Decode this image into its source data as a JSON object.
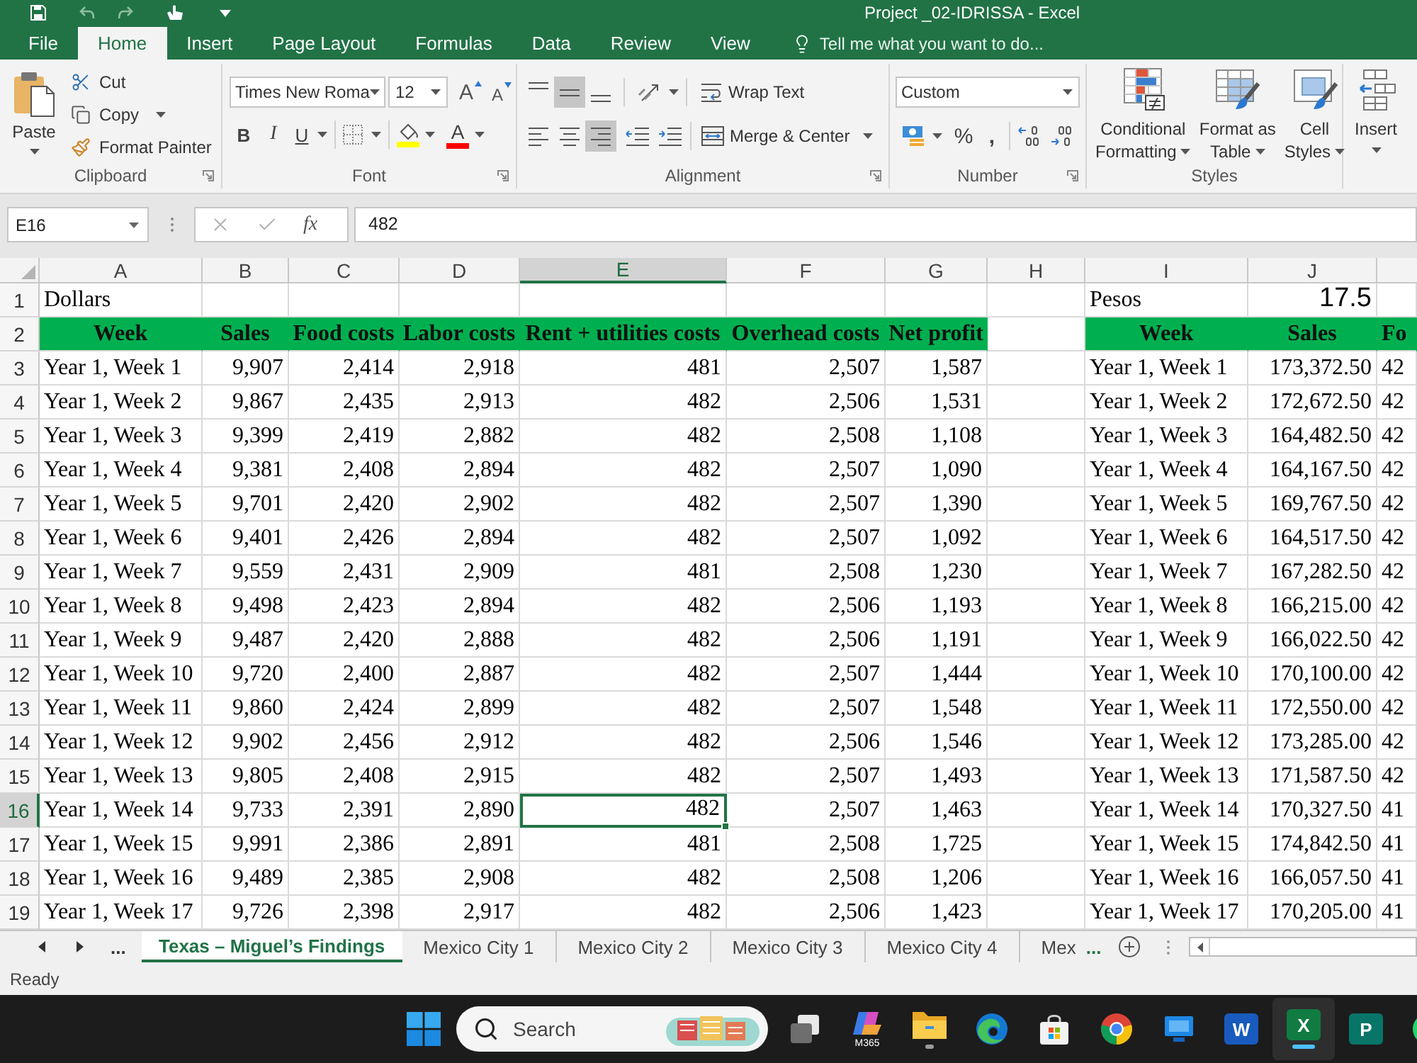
{
  "title_bar": {
    "title": "Project _02-IDRISSA - Excel"
  },
  "ribbon_tabs": [
    {
      "label": "File",
      "selected": false
    },
    {
      "label": "Home",
      "selected": true
    },
    {
      "label": "Insert",
      "selected": false
    },
    {
      "label": "Page Layout",
      "selected": false
    },
    {
      "label": "Formulas",
      "selected": false
    },
    {
      "label": "Data",
      "selected": false
    },
    {
      "label": "Review",
      "selected": false
    },
    {
      "label": "View",
      "selected": false
    }
  ],
  "tell_me": {
    "placeholder": "Tell me what you want to do..."
  },
  "ribbon": {
    "clipboard": {
      "label": "Clipboard",
      "paste": "Paste",
      "cut": "Cut",
      "copy": "Copy",
      "format_painter": "Format Painter"
    },
    "font": {
      "label": "Font",
      "font_name": "Times New Roma",
      "font_size": "12",
      "grow": "A",
      "shrink": "A",
      "bold": "B",
      "italic": "I",
      "underline": "U",
      "font_color": "A"
    },
    "alignment": {
      "label": "Alignment",
      "vertical": [
        {
          "kind": "top",
          "selected": false
        },
        {
          "kind": "middle",
          "selected": true
        },
        {
          "kind": "bottom",
          "selected": false
        }
      ],
      "horizontal": [
        {
          "kind": "left",
          "selected": false
        },
        {
          "kind": "center",
          "selected": false
        },
        {
          "kind": "right",
          "selected": true
        }
      ],
      "wrap_text": "Wrap Text",
      "merge_center": "Merge & Center"
    },
    "number": {
      "label": "Number",
      "format": "Custom",
      "percent": "%",
      "comma": ","
    },
    "styles": {
      "label": "Styles",
      "buttons": [
        {
          "kind": "conditional",
          "line_1": "Conditional",
          "line_2": "Formatting"
        },
        {
          "kind": "table",
          "line_1": "Format as",
          "line_2": "Table"
        },
        {
          "kind": "cell",
          "line_1": "Cell",
          "line_2": "Styles"
        }
      ]
    },
    "cells": {
      "insert": "Insert"
    }
  },
  "formula_bar": {
    "name_box": "E16",
    "fx": "fx",
    "value": "482"
  },
  "sheet": {
    "columns": [
      {
        "label": "A",
        "selected": false
      },
      {
        "label": "B",
        "selected": false
      },
      {
        "label": "C",
        "selected": false
      },
      {
        "label": "D",
        "selected": false
      },
      {
        "label": "E",
        "selected": true
      },
      {
        "label": "F",
        "selected": false
      },
      {
        "label": "G",
        "selected": false
      },
      {
        "label": "H",
        "selected": false
      },
      {
        "label": "I",
        "selected": false
      },
      {
        "label": "J",
        "selected": false
      }
    ],
    "row_headers": [
      {
        "label": "1",
        "selected": false
      },
      {
        "label": "2",
        "selected": false
      },
      {
        "label": "3",
        "selected": false
      },
      {
        "label": "4",
        "selected": false
      },
      {
        "label": "5",
        "selected": false
      },
      {
        "label": "6",
        "selected": false
      },
      {
        "label": "7",
        "selected": false
      },
      {
        "label": "8",
        "selected": false
      },
      {
        "label": "9",
        "selected": false
      },
      {
        "label": "10",
        "selected": false
      },
      {
        "label": "11",
        "selected": false
      },
      {
        "label": "12",
        "selected": false
      },
      {
        "label": "13",
        "selected": false
      },
      {
        "label": "14",
        "selected": false
      },
      {
        "label": "15",
        "selected": false
      },
      {
        "label": "16",
        "selected": true
      },
      {
        "label": "17",
        "selected": false
      },
      {
        "label": "18",
        "selected": false
      },
      {
        "label": "19",
        "selected": false
      }
    ],
    "dollars_table": {
      "title": "Dollars",
      "headers": [
        "Week",
        "Sales",
        "Food costs",
        "Labor costs",
        "Rent + utilities costs",
        "Overhead costs",
        "Net profit"
      ],
      "rows": [
        {
          "week": "Year 1, Week 1",
          "values": [
            "9,907",
            "2,414",
            "2,918",
            "481",
            "2,507",
            "1,587"
          ]
        },
        {
          "week": "Year 1, Week 2",
          "values": [
            "9,867",
            "2,435",
            "2,913",
            "482",
            "2,506",
            "1,531"
          ]
        },
        {
          "week": "Year 1, Week 3",
          "values": [
            "9,399",
            "2,419",
            "2,882",
            "482",
            "2,508",
            "1,108"
          ]
        },
        {
          "week": "Year 1, Week 4",
          "values": [
            "9,381",
            "2,408",
            "2,894",
            "482",
            "2,507",
            "1,090"
          ]
        },
        {
          "week": "Year 1, Week 5",
          "values": [
            "9,701",
            "2,420",
            "2,902",
            "482",
            "2,507",
            "1,390"
          ]
        },
        {
          "week": "Year 1, Week 6",
          "values": [
            "9,401",
            "2,426",
            "2,894",
            "482",
            "2,507",
            "1,092"
          ]
        },
        {
          "week": "Year 1, Week 7",
          "values": [
            "9,559",
            "2,431",
            "2,909",
            "481",
            "2,508",
            "1,230"
          ]
        },
        {
          "week": "Year 1, Week 8",
          "values": [
            "9,498",
            "2,423",
            "2,894",
            "482",
            "2,506",
            "1,193"
          ]
        },
        {
          "week": "Year 1, Week 9",
          "values": [
            "9,487",
            "2,420",
            "2,888",
            "482",
            "2,506",
            "1,191"
          ]
        },
        {
          "week": "Year 1, Week 10",
          "values": [
            "9,720",
            "2,400",
            "2,887",
            "482",
            "2,507",
            "1,444"
          ]
        },
        {
          "week": "Year 1, Week 11",
          "values": [
            "9,860",
            "2,424",
            "2,899",
            "482",
            "2,507",
            "1,548"
          ]
        },
        {
          "week": "Year 1, Week 12",
          "values": [
            "9,902",
            "2,456",
            "2,912",
            "482",
            "2,506",
            "1,546"
          ]
        },
        {
          "week": "Year 1, Week 13",
          "values": [
            "9,805",
            "2,408",
            "2,915",
            "482",
            "2,507",
            "1,493"
          ]
        },
        {
          "week": "Year 1, Week 14",
          "values": [
            "9,733",
            "2,391",
            "2,890",
            "482",
            "2,507",
            "1,463"
          ]
        },
        {
          "week": "Year 1, Week 15",
          "values": [
            "9,991",
            "2,386",
            "2,891",
            "481",
            "2,508",
            "1,725"
          ]
        },
        {
          "week": "Year 1, Week 16",
          "values": [
            "9,489",
            "2,385",
            "2,908",
            "482",
            "2,508",
            "1,206"
          ]
        },
        {
          "week": "Year 1, Week 17",
          "values": [
            "9,726",
            "2,398",
            "2,917",
            "482",
            "2,506",
            "1,423"
          ]
        }
      ]
    },
    "pesos_table": {
      "title": "Pesos",
      "rate": "17.5",
      "headers": [
        "Week",
        "Sales",
        "Fo"
      ],
      "rows": [
        {
          "week": "Year 1, Week 1",
          "values": [
            "173,372.50",
            "42"
          ]
        },
        {
          "week": "Year 1, Week 2",
          "values": [
            "172,672.50",
            "42"
          ]
        },
        {
          "week": "Year 1, Week 3",
          "values": [
            "164,482.50",
            "42"
          ]
        },
        {
          "week": "Year 1, Week 4",
          "values": [
            "164,167.50",
            "42"
          ]
        },
        {
          "week": "Year 1, Week 5",
          "values": [
            "169,767.50",
            "42"
          ]
        },
        {
          "week": "Year 1, Week 6",
          "values": [
            "164,517.50",
            "42"
          ]
        },
        {
          "week": "Year 1, Week 7",
          "values": [
            "167,282.50",
            "42"
          ]
        },
        {
          "week": "Year 1, Week 8",
          "values": [
            "166,215.00",
            "42"
          ]
        },
        {
          "week": "Year 1, Week 9",
          "values": [
            "166,022.50",
            "42"
          ]
        },
        {
          "week": "Year 1, Week 10",
          "values": [
            "170,100.00",
            "42"
          ]
        },
        {
          "week": "Year 1, Week 11",
          "values": [
            "172,550.00",
            "42"
          ]
        },
        {
          "week": "Year 1, Week 12",
          "values": [
            "173,285.00",
            "42"
          ]
        },
        {
          "week": "Year 1, Week 13",
          "values": [
            "171,587.50",
            "42"
          ]
        },
        {
          "week": "Year 1, Week 14",
          "values": [
            "170,327.50",
            "41"
          ]
        },
        {
          "week": "Year 1, Week 15",
          "values": [
            "174,842.50",
            "41"
          ]
        },
        {
          "week": "Year 1, Week 16",
          "values": [
            "166,057.50",
            "41"
          ]
        },
        {
          "week": "Year 1, Week 17",
          "values": [
            "170,205.00",
            "41"
          ]
        }
      ]
    }
  },
  "sheet_nav": {
    "more_left": "...",
    "more_right": "..."
  },
  "sheet_tabs": [
    {
      "label": "Texas – Miguel’s Findings",
      "selected": true
    },
    {
      "label": "Mexico City 1",
      "selected": false
    },
    {
      "label": "Mexico City 2",
      "selected": false
    },
    {
      "label": "Mexico City 3",
      "selected": false
    },
    {
      "label": "Mexico City 4",
      "selected": false
    },
    {
      "label": "Mex",
      "selected": false
    }
  ],
  "status_bar": {
    "text": "Ready"
  },
  "taskbar": {
    "search": {
      "placeholder": "Search"
    },
    "apps": [
      {
        "kind": "task_view",
        "running": false,
        "active": false
      },
      {
        "kind": "copilot",
        "label": "M365",
        "running": false,
        "active": false
      },
      {
        "kind": "file_explorer",
        "running": true,
        "active": false
      },
      {
        "kind": "edge",
        "running": false,
        "active": false
      },
      {
        "kind": "store",
        "running": false,
        "active": false
      },
      {
        "kind": "chrome",
        "running": false,
        "active": false
      },
      {
        "kind": "blue_app",
        "running": false,
        "active": false
      },
      {
        "kind": "word",
        "glyph": "W",
        "running": false,
        "active": false
      },
      {
        "kind": "excel",
        "glyph": "X",
        "running": true,
        "active": true
      },
      {
        "kind": "publisher",
        "glyph": "P",
        "running": false,
        "active": false
      },
      {
        "kind": "green_app",
        "running": false,
        "active": false
      }
    ]
  }
}
